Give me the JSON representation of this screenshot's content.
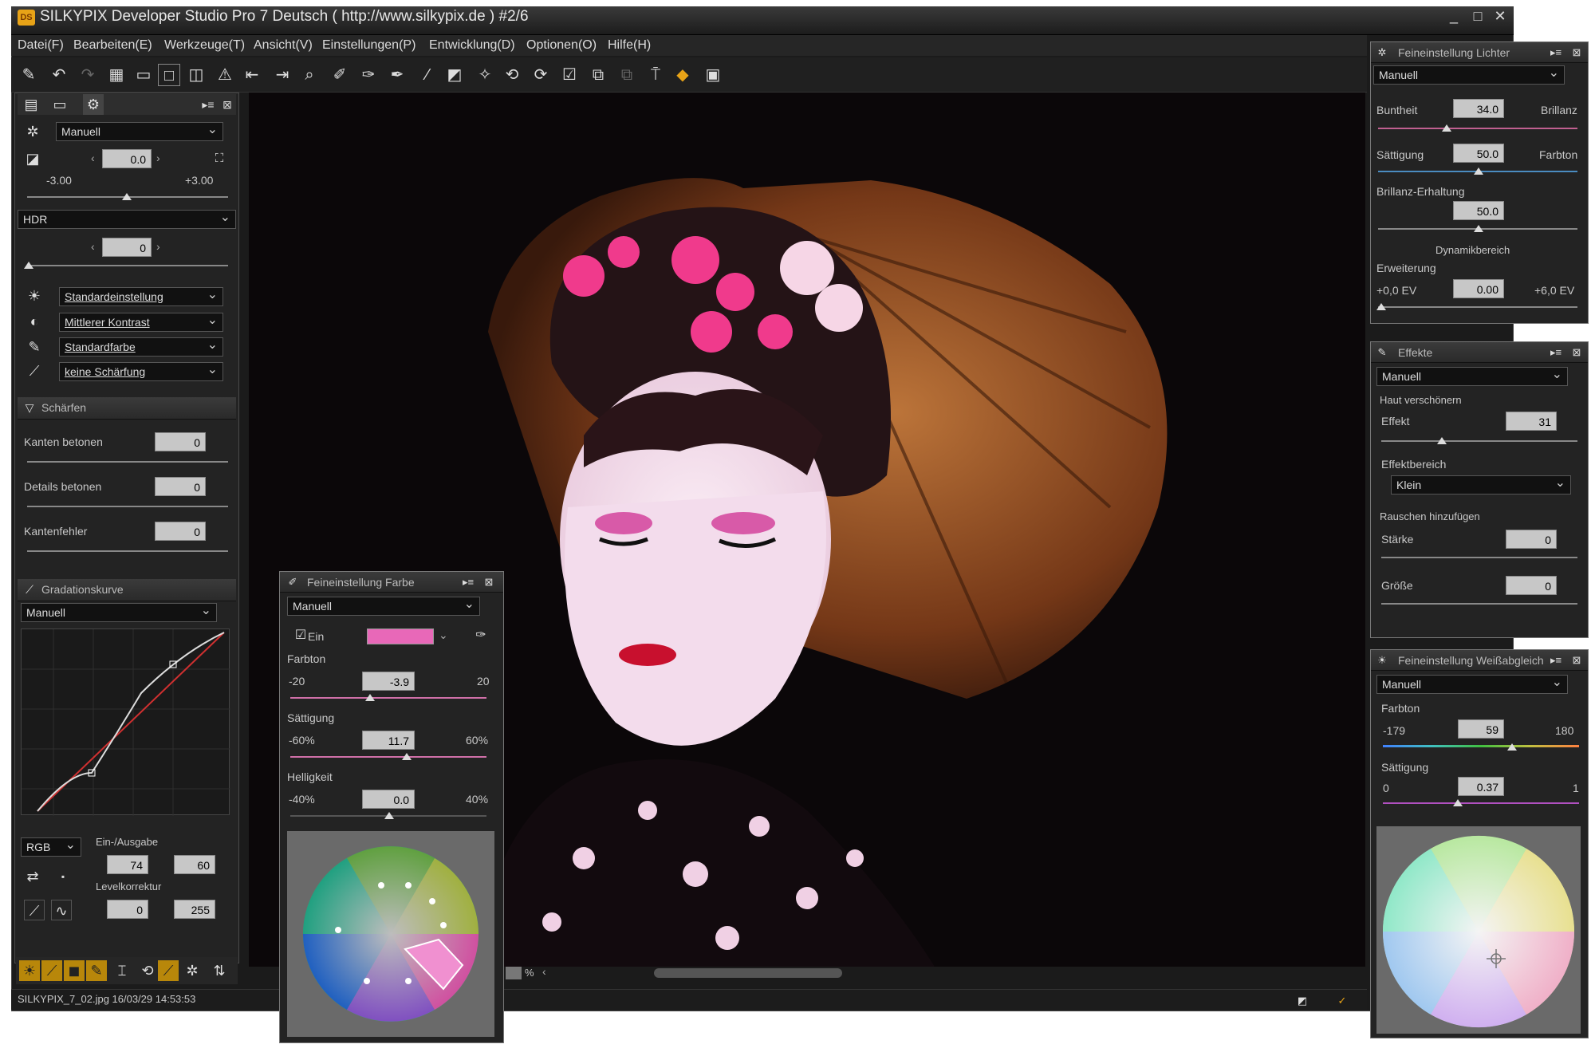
{
  "window": {
    "title": "SILKYPIX Developer Studio Pro 7 Deutsch ( http://www.silkypix.de )   #2/6",
    "app_icon": "DS",
    "controls": [
      "_",
      "□",
      "✕"
    ]
  },
  "menu": [
    "Datei(F)",
    "Bearbeiten(E)",
    "Werkzeuge(T)",
    "Ansicht(V)",
    "Einstellungen(P)",
    "Entwicklung(D)",
    "Optionen(O)",
    "Hilfe(H)"
  ],
  "left": {
    "preset": "Manuell",
    "exposure": {
      "value": "0.0",
      "min": "-3.00",
      "max": "+3.00"
    },
    "hdr": {
      "label": "HDR",
      "value": "0"
    },
    "dropdowns": [
      "Standardeinstellung",
      "Mittlerer Kontrast",
      "Standardfarbe",
      "keine Schärfung"
    ],
    "sharpen": {
      "title": "Schärfen",
      "rows": [
        {
          "label": "Kanten betonen",
          "value": "0"
        },
        {
          "label": "Details betonen",
          "value": "0"
        },
        {
          "label": "Kantenfehler",
          "value": "0"
        }
      ]
    },
    "curve": {
      "title": "Gradationskurve",
      "preset": "Manuell",
      "channel": "RGB",
      "io_label": "Ein-/Ausgabe",
      "in": "74",
      "out": "60",
      "level_label": "Levelkorrektur",
      "level_min": "0",
      "level_max": "255"
    }
  },
  "farbe": {
    "title": "Feineinstellung Farbe",
    "preset": "Manuell",
    "enabled_label": "Ein",
    "swatch": "#e868b8",
    "farbton": {
      "label": "Farbton",
      "min": "-20",
      "max": "20",
      "value": "-3.9"
    },
    "saettigung": {
      "label": "Sättigung",
      "min": "-60%",
      "max": "60%",
      "value": "11.7"
    },
    "helligkeit": {
      "label": "Helligkeit",
      "min": "-40%",
      "max": "40%",
      "value": "0.0"
    }
  },
  "lichter": {
    "title": "Feineinstellung Lichter",
    "preset": "Manuell",
    "rows": [
      {
        "left": "Buntheit",
        "right": "Brillanz",
        "value": "34.0"
      },
      {
        "left": "Sättigung",
        "right": "Farbton",
        "value": "50.0"
      },
      {
        "left": "Brillanz-Erhaltung",
        "right": "",
        "value": "50.0"
      }
    ],
    "dyn_label": "Dynamikbereich",
    "ext_label": "Erweiterung",
    "ext_min": "+0,0 EV",
    "ext_max": "+6,0 EV",
    "ext_value": "0.00"
  },
  "effekte": {
    "title": "Effekte",
    "preset": "Manuell",
    "haut_label": "Haut verschönern",
    "effekt_label": "Effekt",
    "effekt_value": "31",
    "bereich_label": "Effektbereich",
    "bereich_value": "Klein",
    "rauschen_label": "Rauschen hinzufügen",
    "staerke_label": "Stärke",
    "staerke_value": "0",
    "groesse_label": "Größe",
    "groesse_value": "0"
  },
  "wb": {
    "title": "Feineinstellung Weißabgleich",
    "preset": "Manuell",
    "farbton_label": "Farbton",
    "farbton_min": "-179",
    "farbton_max": "180",
    "farbton_value": "59",
    "saett_label": "Sättigung",
    "saett_min": "0",
    "saett_max": "1",
    "saett_value": "0.37"
  },
  "status": {
    "file": "SILKYPIX_7_02.jpg 16/03/29 14:53:53",
    "zoom": "%"
  }
}
